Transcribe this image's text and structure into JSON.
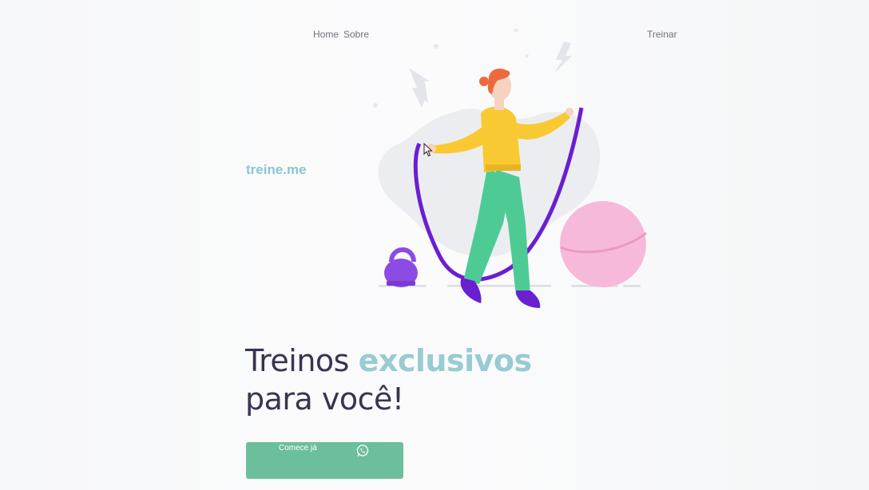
{
  "nav": {
    "home_label": "Home",
    "sobre_label": "Sobre",
    "treinar_label": "Treinar"
  },
  "brand": {
    "logo_text": "treine.me"
  },
  "hero": {
    "title_part1": "Treinos ",
    "title_accent": "exclusivos",
    "title_part2": "para você!"
  },
  "cta": {
    "label": "Comece já",
    "icon": "whatsapp-icon"
  },
  "colors": {
    "accent": "#98cbd2",
    "brand": "#8cc6cf",
    "button": "#6cbf9c",
    "title": "#3a3350"
  }
}
